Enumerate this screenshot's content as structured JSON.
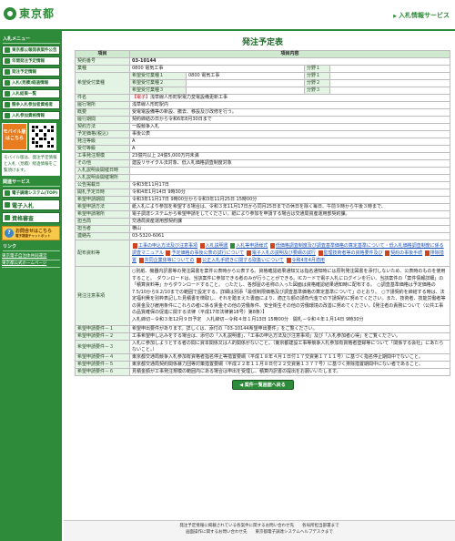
{
  "header": {
    "site_name": "東京都",
    "service_name": "入札情報サービス"
  },
  "sidebar": {
    "section_menu": "入札メニュー",
    "items": [
      {
        "label": "東京都公報発表案件公告"
      },
      {
        "label": "年間発注予定情報"
      },
      {
        "label": "発注予定情報"
      },
      {
        "label": "入札(見積)経過情報"
      },
      {
        "label": "入札結果一覧"
      },
      {
        "label": "競争入札参加者資格者"
      },
      {
        "label": "入札参加資格情報"
      }
    ],
    "mobile_label": "モバイル版はこちら",
    "mobile_note": "モバイル版は、発注予定情報と入札（見積）経過情報をご覧頂けます。",
    "section_service": "関連サービス",
    "service_items": [
      {
        "label": "電子調達システム(TOP)"
      },
      {
        "label": "電子入札"
      },
      {
        "label": "資格審査"
      }
    ],
    "faq_label": "お問合せはこちら",
    "faq_sub": "電子調達チャットボット",
    "section_links": "リンク",
    "links": [
      {
        "label": "東京電子自治体共同運営"
      },
      {
        "label": "東京都公式ホームページ"
      }
    ]
  },
  "main": {
    "title": "発注予定表",
    "head_item": "項目",
    "head_content": "項目内容",
    "rows": {
      "contract_no": {
        "label": "契約番号",
        "value": "03-10144"
      },
      "industry": {
        "label": "業種",
        "value": "0800 電気工事"
      },
      "bunya1": "分野１",
      "bunya2": "分野２",
      "bunya3": "分野３",
      "desired_types_label": "希望受付業種",
      "desired_types": [
        {
          "label": "希望受付業種１",
          "value": "0800 電気工事"
        },
        {
          "label": "希望受付業種２",
          "value": ""
        },
        {
          "label": "希望受付業種３",
          "value": ""
        }
      ],
      "subject": {
        "label": "件名",
        "tag": "【電子】",
        "value": "浅草線人形町駅電力変電設備更新工事"
      },
      "location": {
        "label": "履行場所",
        "value": "浅草線人形町駅内"
      },
      "summary": {
        "label": "概要",
        "value": "受電電設備等の新設、撤去、移設及び改修を行う。"
      },
      "period": {
        "label": "履行期間",
        "value": "契約締結の日から令和6年8月30日まで"
      },
      "method": {
        "label": "契約方法",
        "value": "一般競争入札"
      },
      "price": {
        "label": "予定価格(税込)",
        "value": "事後公表"
      },
      "order_type": {
        "label": "発注等級",
        "value": "A"
      },
      "accept_type": {
        "label": "受付等級",
        "value": "A"
      },
      "scale": {
        "label": "工事発注規模",
        "value": "23億円以上 24億5,000万円未満"
      },
      "other": {
        "label": "その他",
        "value": "建設リサイクル法対象、低入札価格調査制度対象"
      },
      "meet_date": {
        "label": "入札説明会開催日時",
        "value": ""
      },
      "meet_place": {
        "label": "入札説明会開催場所",
        "value": ""
      },
      "publish_date": {
        "label": "公告掲載日",
        "value": "令和3年11月17日"
      },
      "open_date": {
        "label": "開札予定日時",
        "value": "令和4年1月14日 9時30分"
      },
      "apply_period": {
        "label": "希望申請期間",
        "value": "令和3年11月17日 9時00分から令和3年11月25日 15時00分"
      },
      "apply_method": {
        "label": "希望申請方法",
        "value": "紙入札により参加を希望する場合は、令和３年11月17日から同月25日までの休日を除く毎日、午前９時から午後３時まで、"
      },
      "apply_place": {
        "label": "希望申請場所",
        "value": "電子調達システムから希望申請をしてください。紙により参加を申請する場合は交通局資産運用部契約課。"
      },
      "dept": {
        "label": "担当局",
        "value": "交通局資産運用部契約課"
      },
      "contact_person": {
        "label": "担当者",
        "value": "横山"
      },
      "phone": {
        "label": "連絡先",
        "value": "03-5320-6061"
      },
      "docs_label": "配布資料等",
      "docs": [
        "工事の申込方法及び注意事項",
        "入札説明書",
        "入札等申請様式",
        "低価格調査制度及び調査基準価格の算定基準について・低入札価格調査制度に係る調査マニュアル",
        "予定価格の事後公表の試行について",
        "電子入札の説明及び要綱の試行",
        "監理技術者等の資格要件及び",
        "契約の事後手続",
        "排除措置",
        "共同企業体等についての",
        "公正入札手続きに関する取扱いについて",
        "令和4年4月適用"
      ],
      "notice": {
        "label": "発注注意事項",
        "value": "○別紙、機器内訳書等の発注図書を案件公表時から公表する。資格確認結果通知又は指名通知時には原則発注図書を添付しないため、公表時のものを使用すること。　ダウンロードは、当該案件に参加できる者のみが行うことができる。ICカードで電子入札にログインを行い、当該案件の「案件情報詳細」の「積算資料等」からダウンロードすること。　○ただし、各部屋の名称の入った図面は資格確認結果通知時に配布する。　○調査基準価格は予定価格の7.5/10から9.2/10までの範囲で設定する。詳細は別添「最低制限価格及び調査基準価格の算定基準について」のとおり。　○下請契約を締結する時は、法定福利費を別枠表記した見積書を徴取し、それを踏まえた書面により、適正な額の請負代金での下請契約に努めてください。また、技術者、技能労働者等の賃金及び雇用条件にこれらの者に係る賃金その他の労働条件、安全衛生その他の労働環境の改善に努めてください。【発注者の責務について（公共工事の品質確保の促進に関する法律（平成17年法律第18号）第8条）】",
        "dates": "入札締切－令和３年12月９日予定　入札締切－令和４年１月13日 15時00分　開札－令和４年１月14日 9時30分"
      },
      "req1": {
        "label": "希望申請要件－１",
        "value": "希望申出要件があります。詳しくは、添付の「03-10144希望申出要件」をご覧ください。"
      },
      "req2": {
        "label": "希望申請要件－２",
        "value": "工事希望申し込みをする場合は、添付の「入札説明書」、「工事の申込方法及び注意事項」及び「入札参加者心得」をご覧ください。"
      },
      "req3": {
        "label": "希望申請要件－３",
        "value": "入札に参加しようとする者の間に資本関係又は人的関係がないこと。（東京都建設工事等競争入札参加有資格者登録等について「関係する会社」にあたらないこと。）"
      },
      "req4": {
        "label": "希望申請要件－４",
        "value": "東京都交通局競争入札参加有資格者指名停止等措置要綱（平成１８年４月１日付１７交資第１７１１号）に基づく指名停止期間中でないこと。"
      },
      "req5": {
        "label": "希望申請要件－５",
        "value": "東京都交通局契約関係暴力団等対策措置要綱（平成２２年１１月８日付２２交資第１３７７号）に基づく排除措置期間中にない者であること。"
      },
      "req6": {
        "label": "希望申請要件－６",
        "value": "見積金額が工事発注規模の範囲内にある場合は申出を受理し、積算内訳書の提出をお願いいたします。"
      }
    },
    "back_label": "案件一覧画面へ戻る"
  },
  "footer": {
    "line1": "発注予定情報に掲載されている各案件に関するお問い合わせ先　　各局所担当部署まで",
    "line2": "画面操作に関するお問い合わせ先　　東京都電子調達システムヘルプデスクまで"
  }
}
